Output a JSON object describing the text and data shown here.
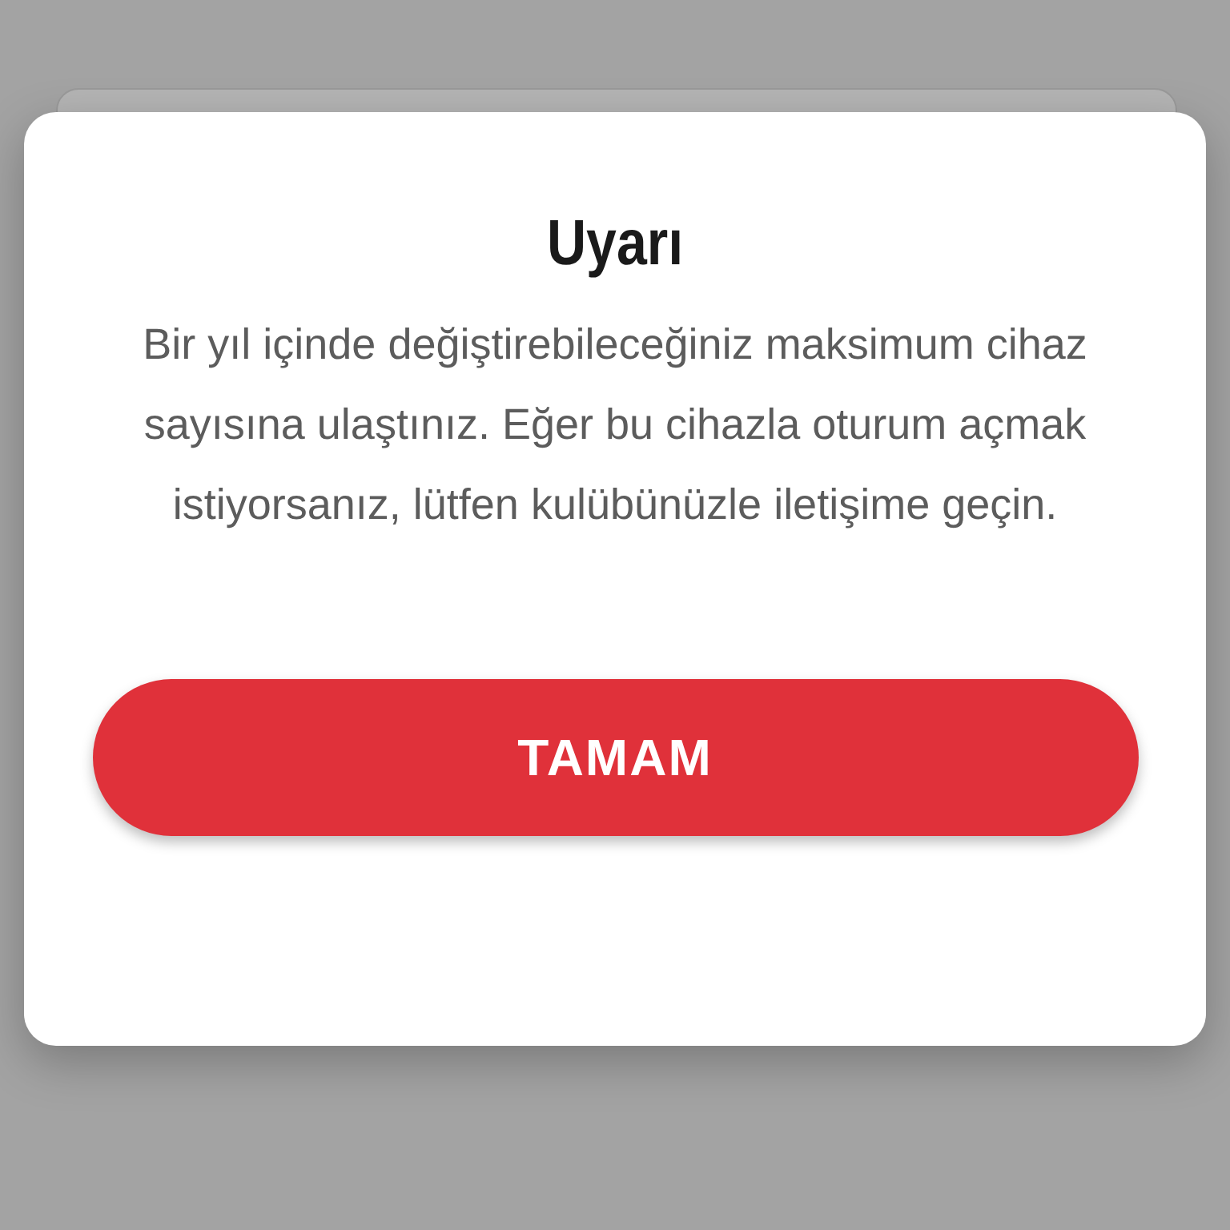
{
  "dialog": {
    "title": "Uyarı",
    "message": "Bir yıl içinde değiştirebileceğiniz maksimum cihaz sayısına ulaştınız. Eğer bu cihazla oturum açmak istiyorsanız, lütfen kulübünüzle iletişime geçin.",
    "button": "TAMAM"
  }
}
